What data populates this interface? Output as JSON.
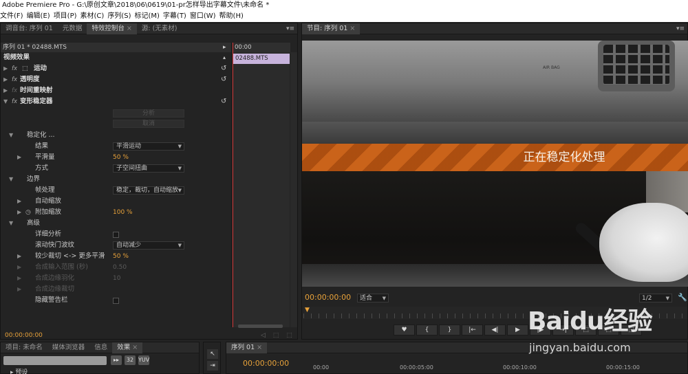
{
  "window": {
    "title": "Adobe Premiere Pro - G:\\原创文章\\2018\\06\\0619\\01-pr怎样导出字幕文件\\未命名 *"
  },
  "menu": [
    "文件(F)",
    "编辑(E)",
    "项目(P)",
    "素材(C)",
    "序列(S)",
    "标记(M)",
    "字幕(T)",
    "窗口(W)",
    "帮助(H)"
  ],
  "source_panel": {
    "tabs": [
      "调音台: 序列 01",
      "元数据",
      "特效控制台",
      "源: (无素材)"
    ],
    "active_tab": "特效控制台"
  },
  "effect_controls": {
    "header": "序列 01 * 02488.MTS",
    "ruler_time": "00:00",
    "clip_name": "02488.MTS",
    "section_title": "视频效果",
    "effects": [
      {
        "name": "运动",
        "icon": "motion-icon"
      },
      {
        "name": "透明度"
      },
      {
        "name": "时间重映射"
      },
      {
        "name": "变形稳定器"
      }
    ],
    "analyze_btn": "分析",
    "cancel_btn": "取消",
    "params": {
      "stabilization": "稳定化 ...",
      "result_label": "结果",
      "result_value": "平滑运动",
      "smoothness_label": "平滑量",
      "smoothness_value": "50 %",
      "method_label": "方式",
      "method_value": "子空间扭曲",
      "borders": "边界",
      "framing_label": "帧处理",
      "framing_value": "稳定，裁切，自动缩放",
      "autoscale_label": "自动缩放",
      "addscale_label": "附加缩放",
      "addscale_value": "100 %",
      "advanced": "高级",
      "detailed_label": "详细分析",
      "rolling_label": "滚动快门波纹",
      "rolling_value": "自动减少",
      "crop_label": "较少裁切 <-> 更多平滑",
      "crop_value": "50 %",
      "synth_range_label": "合成输入范围 (秒)",
      "synth_range_value": "0.50",
      "synth_feather_label": "合成边缘羽化",
      "synth_feather_value": "10",
      "synth_crop_label": "合成边缘裁切",
      "hide_warning_label": "隐藏警告栏"
    },
    "time": "00:00:00:00"
  },
  "program_monitor": {
    "tab": "节目: 序列 01",
    "overlay_text": "正在稳定化处理",
    "airbag_label": "AIR BAG",
    "time": "00:00:00:00",
    "fit": "适合",
    "resolution": "1/2",
    "transport": [
      "♥",
      "{",
      "}",
      "|←",
      "◀|",
      "▶",
      "|▶",
      "→|",
      "⬚",
      "⬚",
      "⬚"
    ]
  },
  "project_panel": {
    "tabs": [
      "项目: 未命名",
      "媒体浏览器",
      "信息",
      "效果"
    ],
    "active_tab": "效果",
    "icons": [
      "▸▸",
      "32",
      "YUV"
    ],
    "folder": "预设"
  },
  "sequence_panel": {
    "tab": "序列 01",
    "time": "00:00:00:00",
    "marks": [
      "00:00",
      "00:00:05:00",
      "00:00:10:00",
      "00:00:15:00"
    ]
  },
  "watermark": {
    "text": "Baidu经验",
    "url": "jingyan.baidu.com"
  },
  "colors": {
    "timecode": "#e8a23a",
    "clip": "#c7b3dc",
    "playhead": "#d03030",
    "overlay_band": "#d9691a"
  }
}
